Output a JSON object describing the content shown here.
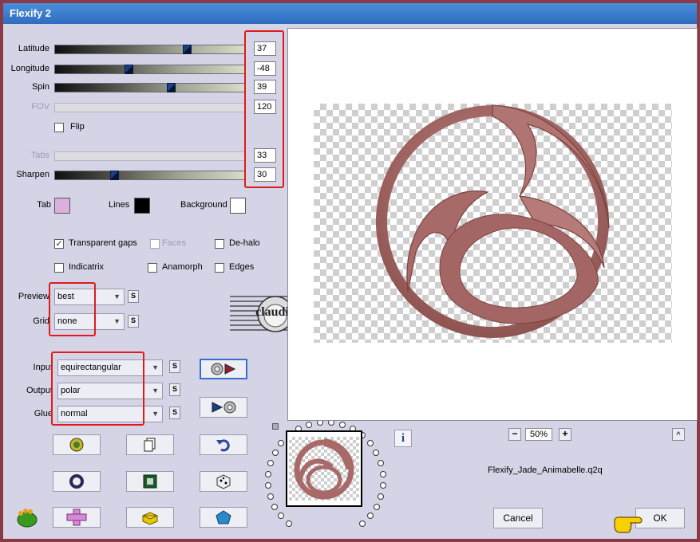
{
  "window": {
    "title": "Flexify 2"
  },
  "sliders": [
    {
      "label": "Latitude",
      "value": "37",
      "fraction": 0.7,
      "enabled": true
    },
    {
      "label": "Longitude",
      "value": "-48",
      "fraction": 0.38,
      "enabled": true
    },
    {
      "label": "Spin",
      "value": "39",
      "fraction": 0.61,
      "enabled": true
    },
    {
      "label": "FOV",
      "value": "120",
      "fraction": null,
      "enabled": false
    },
    {
      "label": "Tabs",
      "value": "33",
      "fraction": null,
      "enabled": false
    },
    {
      "label": "Sharpen",
      "value": "30",
      "fraction": 0.3,
      "enabled": true
    }
  ],
  "flip": {
    "label": "Flip",
    "checked": false
  },
  "colors": {
    "tab_label": "Tab",
    "tab_color": "#dcb0dc",
    "lines_label": "Lines",
    "lines_color": "#000000",
    "background_label": "Background",
    "background_color": "#ffffff",
    "highlight": "#e11a1a",
    "ring": "#a86a68"
  },
  "checkboxes": {
    "transparent_gaps": {
      "label": "Transparent gaps",
      "checked": true
    },
    "faces": {
      "label": "Faces",
      "checked": false
    },
    "de_halo": {
      "label": "De-halo",
      "checked": false
    },
    "indicatrix": {
      "label": "Indicatrix",
      "checked": false
    },
    "anamorph": {
      "label": "Anamorph",
      "checked": false
    },
    "edges": {
      "label": "Edges",
      "checked": false
    }
  },
  "dropdowns": {
    "preview": {
      "label": "Preview",
      "value": "best"
    },
    "grid": {
      "label": "Grid",
      "value": "none"
    },
    "input": {
      "label": "Input",
      "value": "equirectangular"
    },
    "output": {
      "label": "Output",
      "value": "polar"
    },
    "glue": {
      "label": "Glue",
      "value": "normal"
    }
  },
  "s_label": "S",
  "zoom": {
    "minus": "−",
    "value": "50%",
    "plus": "+"
  },
  "caret": "^",
  "preset_name": "Flexify_Jade_Animabelle.q2q",
  "buttons": {
    "cancel": "Cancel",
    "ok": "OK"
  },
  "watermark": "claudia",
  "icons": {
    "input_output": "sphere-to-triangle-icon",
    "output_input": "triangle-to-sphere-icon",
    "randomize": "randomize-icon",
    "copy": "copy-pages-icon",
    "undo": "undo-arrow-icon",
    "ring": "ring-icon",
    "square": "square-frame-icon",
    "dice": "dice-icon",
    "tiles": "cross-tiles-icon",
    "lego": "brick-icon",
    "polyhedron": "pentagon-icon",
    "plugin": "plugin-logo-icon",
    "info": "info-icon",
    "hand": "pointing-hand-icon"
  }
}
